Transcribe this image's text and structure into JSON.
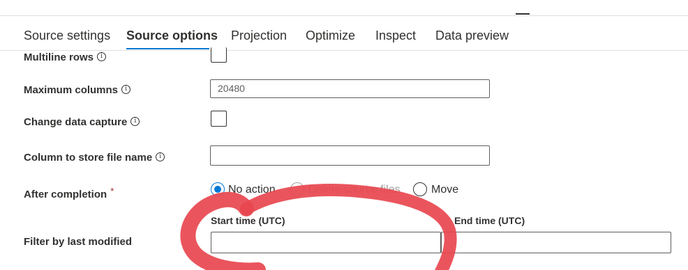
{
  "tabs": {
    "source_settings": "Source settings",
    "source_options": "Source options",
    "projection": "Projection",
    "optimize": "Optimize",
    "inspect": "Inspect",
    "data_preview": "Data preview"
  },
  "form": {
    "multiline_rows": {
      "label": "Multiline rows",
      "checked": false
    },
    "maximum_columns": {
      "label": "Maximum columns",
      "value": "20480"
    },
    "change_data_capture": {
      "label": "Change data capture",
      "checked": false
    },
    "column_to_store_file_name": {
      "label": "Column to store file name",
      "value": ""
    },
    "after_completion": {
      "label": "After completion",
      "required_mark": "*",
      "options": {
        "no_action": "No action",
        "delete_source_files": "Delete source files",
        "move": "Move"
      },
      "selected": "No action"
    },
    "filter_by_last_modified": {
      "label": "Filter by last modified",
      "start_label": "Start time (UTC)",
      "end_label": "End time (UTC)",
      "start_value": "",
      "end_value": ""
    }
  },
  "info_glyph": "i",
  "annotation_color": "#e8474f",
  "accent_color": "#0078d4"
}
